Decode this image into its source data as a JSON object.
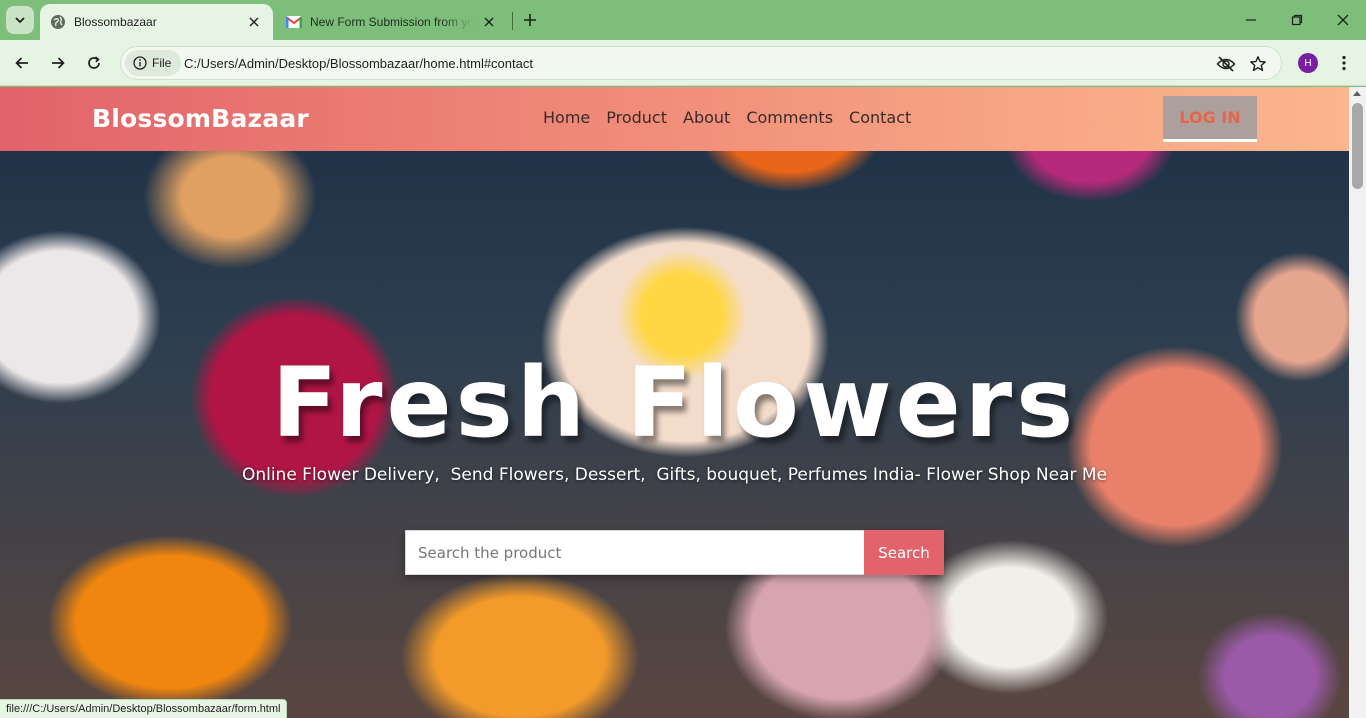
{
  "browser": {
    "tabs": [
      {
        "title": "Blossombazaar",
        "icon": "globe-icon"
      },
      {
        "title": "New Form Submission from your",
        "icon": "gmail-icon"
      }
    ],
    "address_chip": "File",
    "url": "C:/Users/Admin/Desktop/Blossombazaar/home.html#contact",
    "profile_initial": "H",
    "status_url": "file:///C:/Users/Admin/Desktop/Blossombazaar/form.html"
  },
  "site": {
    "brand": "BlossomBazaar",
    "nav": [
      "Home",
      "Product",
      "About",
      "Comments",
      "Contact"
    ],
    "login_label": "LOG IN",
    "hero_title": "Fresh Flowers",
    "hero_subtitle": "Online Flower Delivery,  Send Flowers, Dessert,  Gifts, bouquet, Perfumes India- Flower Shop Near Me",
    "search_placeholder": "Search the product",
    "search_button": "Search"
  },
  "colors": {
    "browser_frame": "#7dbf7a",
    "nav_gradient_start": "#e2636a",
    "nav_gradient_end": "#fcb58d",
    "login_bg": "#ad9f9c",
    "login_text": "#e56649",
    "search_button": "#e2636a"
  }
}
